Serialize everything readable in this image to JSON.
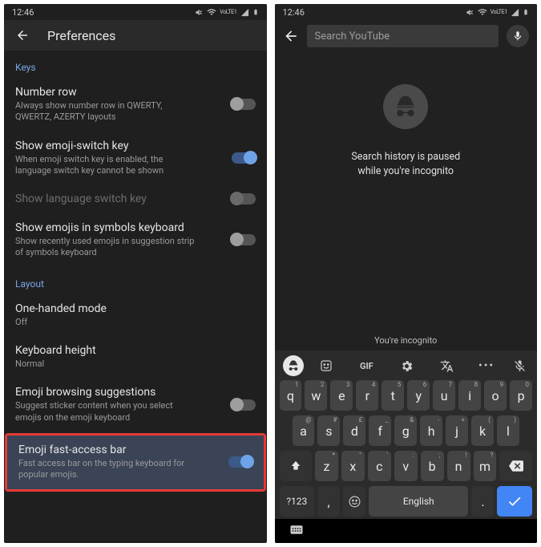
{
  "status": {
    "time": "12:46",
    "vo_label": "VoLTE1"
  },
  "left": {
    "title": "Preferences",
    "sections": {
      "keys": {
        "title": "Keys",
        "number_row": {
          "label": "Number row",
          "desc": "Always show number row in QWERTY, QWERTZ, AZERTY layouts",
          "on": false
        },
        "emoji_switch": {
          "label": "Show emoji-switch key",
          "desc": "When emoji switch key is enabled, the language switch key cannot be shown",
          "on": true
        },
        "lang_switch": {
          "label": "Show language switch key",
          "on": false,
          "disabled": true
        },
        "emojis_symbols": {
          "label": "Show emojis in symbols keyboard",
          "desc": "Show recently used emojis in suggestion strip of symbols keyboard",
          "on": false
        }
      },
      "layout": {
        "title": "Layout",
        "one_handed": {
          "label": "One-handed mode",
          "desc": "Off"
        },
        "kbd_height": {
          "label": "Keyboard height",
          "desc": "Normal"
        },
        "emoji_browse": {
          "label": "Emoji browsing suggestions",
          "desc": "Suggest sticker content when you select emojis on the emoji keyboard",
          "on": false
        },
        "fast_access": {
          "label": "Emoji fast-access bar",
          "desc": "Fast access bar on the typing keyboard for popular emojis.",
          "on": true
        }
      }
    }
  },
  "right": {
    "search_placeholder": "Search YouTube",
    "incognito_title_line1": "Search history is paused",
    "incognito_title_line2": "while you're incognito",
    "incognito_footer": "You're incognito",
    "keyboard": {
      "gif_label": "GIF",
      "rows": {
        "r1": [
          {
            "k": "q",
            "s": "1"
          },
          {
            "k": "w",
            "s": "2"
          },
          {
            "k": "e",
            "s": "3"
          },
          {
            "k": "r",
            "s": "4"
          },
          {
            "k": "t",
            "s": "5"
          },
          {
            "k": "y",
            "s": "6"
          },
          {
            "k": "u",
            "s": "7"
          },
          {
            "k": "i",
            "s": "8"
          },
          {
            "k": "o",
            "s": "9"
          },
          {
            "k": "p",
            "s": "0"
          }
        ],
        "r2": [
          {
            "k": "a",
            "s": "@"
          },
          {
            "k": "s",
            "s": "#"
          },
          {
            "k": "d",
            "s": "£"
          },
          {
            "k": "f",
            "s": "_"
          },
          {
            "k": "g",
            "s": "&"
          },
          {
            "k": "h",
            "s": "-"
          },
          {
            "k": "j",
            "s": "+"
          },
          {
            "k": "k",
            "s": "("
          },
          {
            "k": "l",
            "s": ")"
          }
        ],
        "r3": [
          {
            "k": "z",
            "s": "*"
          },
          {
            "k": "x",
            "s": "\""
          },
          {
            "k": "c",
            "s": "'"
          },
          {
            "k": "v",
            "s": ":"
          },
          {
            "k": "b",
            "s": ";"
          },
          {
            "k": "n",
            "s": "!"
          },
          {
            "k": "m",
            "s": "?"
          }
        ]
      },
      "sym_label": "?123",
      "space_label": "English"
    }
  }
}
